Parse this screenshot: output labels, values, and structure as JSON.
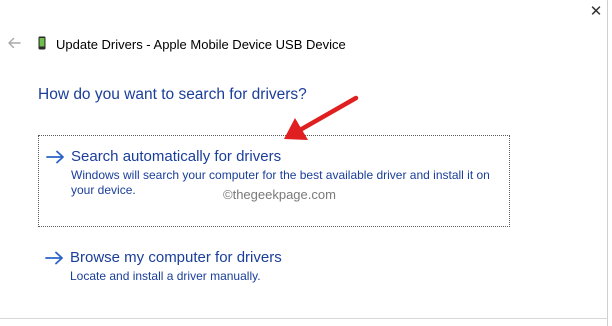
{
  "window": {
    "title": "Update Drivers - Apple Mobile Device USB Device",
    "close_glyph": "✕",
    "back_icon": "back-arrow-icon",
    "device_icon": "phone-device-icon"
  },
  "main": {
    "question": "How do you want to search for drivers?",
    "options": [
      {
        "title": "Search automatically for drivers",
        "description": "Windows will search your computer for the best available driver and install it on your device.",
        "icon": "right-arrow-icon"
      },
      {
        "title": "Browse my computer for drivers",
        "description": "Locate and install a driver manually.",
        "icon": "right-arrow-icon"
      }
    ]
  },
  "watermark": "©thegeekpage.com",
  "annotation": {
    "icon": "red-pointer-arrow",
    "color": "#e02020"
  },
  "colors": {
    "link_blue": "#1a3e9a",
    "arrow_blue": "#2a63c9"
  }
}
